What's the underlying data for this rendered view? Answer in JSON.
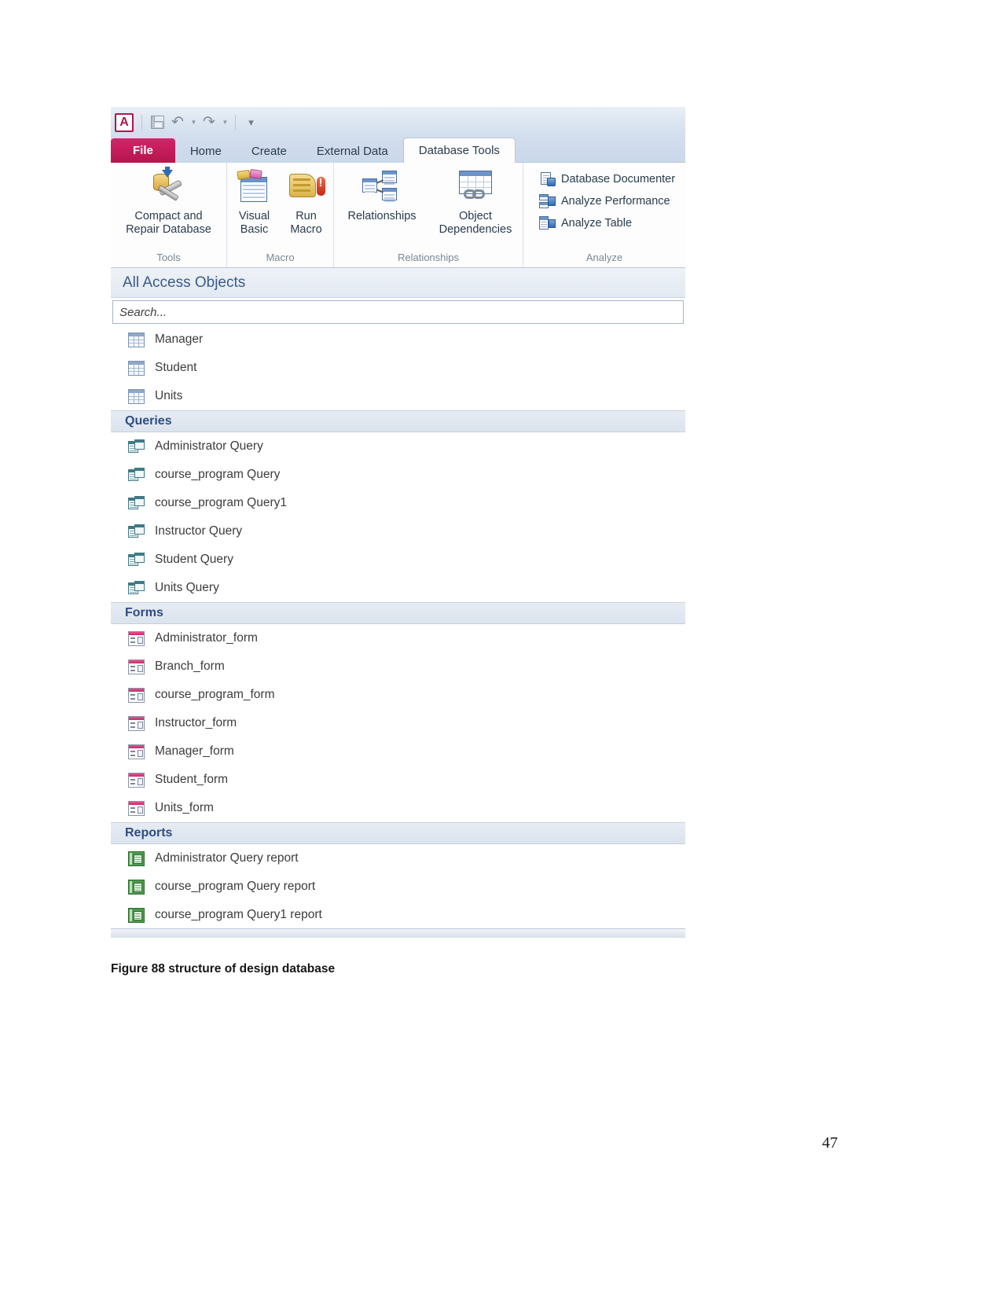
{
  "document": {
    "figure_caption": "Figure 88 structure of design database",
    "page_number": "47"
  },
  "app": {
    "quick_access": {
      "logo": "A",
      "save_icon": "save-icon",
      "undo_icon": "undo-icon",
      "redo_icon": "redo-icon",
      "customize_icon": "customize-quick-access-icon"
    },
    "tabs": [
      {
        "label": "File",
        "active": false,
        "file": true
      },
      {
        "label": "Home",
        "active": false,
        "file": false
      },
      {
        "label": "Create",
        "active": false,
        "file": false
      },
      {
        "label": "External Data",
        "active": false,
        "file": false
      },
      {
        "label": "Database Tools",
        "active": true,
        "file": false
      }
    ],
    "ribbon": {
      "groups": [
        {
          "label": "Tools",
          "buttons": [
            {
              "label": "Compact and\nRepair Database",
              "icon": "compact-repair-database-icon",
              "size": "large"
            }
          ]
        },
        {
          "label": "Macro",
          "buttons": [
            {
              "label": "Visual\nBasic",
              "icon": "visual-basic-icon",
              "size": "large"
            },
            {
              "label": "Run\nMacro",
              "icon": "run-macro-icon",
              "size": "large"
            }
          ]
        },
        {
          "label": "Relationships",
          "buttons": [
            {
              "label": "Relationships",
              "icon": "relationships-icon",
              "size": "large"
            },
            {
              "label": "Object\nDependencies",
              "icon": "object-dependencies-icon",
              "size": "large"
            }
          ]
        },
        {
          "label": "Analyze",
          "buttons": [
            {
              "label": "Database Documenter",
              "icon": "database-documenter-icon",
              "size": "small"
            },
            {
              "label": "Analyze Performance",
              "icon": "analyze-performance-icon",
              "size": "small"
            },
            {
              "label": "Analyze Table",
              "icon": "analyze-table-icon",
              "size": "small"
            }
          ]
        }
      ]
    },
    "navigation_pane": {
      "title": "All Access Objects",
      "search_placeholder": "Search...",
      "groups": [
        {
          "header": null,
          "type": "tables",
          "items": [
            {
              "label": "Manager",
              "icon": "table-icon"
            },
            {
              "label": "Student",
              "icon": "table-icon"
            },
            {
              "label": "Units",
              "icon": "table-icon"
            }
          ]
        },
        {
          "header": "Queries",
          "type": "queries",
          "items": [
            {
              "label": "Administrator Query",
              "icon": "query-icon"
            },
            {
              "label": "course_program Query",
              "icon": "query-icon"
            },
            {
              "label": "course_program Query1",
              "icon": "query-icon"
            },
            {
              "label": "Instructor Query",
              "icon": "query-icon"
            },
            {
              "label": "Student Query",
              "icon": "query-icon"
            },
            {
              "label": "Units Query",
              "icon": "query-icon"
            }
          ]
        },
        {
          "header": "Forms",
          "type": "forms",
          "items": [
            {
              "label": "Administrator_form",
              "icon": "form-icon"
            },
            {
              "label": "Branch_form",
              "icon": "form-icon"
            },
            {
              "label": "course_program_form",
              "icon": "form-icon"
            },
            {
              "label": "Instructor_form",
              "icon": "form-icon"
            },
            {
              "label": "Manager_form",
              "icon": "form-icon"
            },
            {
              "label": "Student_form",
              "icon": "form-icon"
            },
            {
              "label": "Units_form",
              "icon": "form-icon"
            }
          ]
        },
        {
          "header": "Reports",
          "type": "reports",
          "items": [
            {
              "label": "Administrator Query report",
              "icon": "report-icon"
            },
            {
              "label": "course_program Query report",
              "icon": "report-icon"
            },
            {
              "label": "course_program Query1 report",
              "icon": "report-icon"
            },
            {
              "label": "",
              "icon": "report-icon",
              "clipped": true
            }
          ]
        }
      ]
    }
  },
  "colors": {
    "file_tab": "#b4154b",
    "nav_header_text": "#3a5a8c",
    "group_header_text": "#2d4d86",
    "report_icon": "#4f9a4f",
    "form_icon_accent": "#c62b6b",
    "query_icon": "#3f7b86",
    "table_icon": "#7b93b5"
  }
}
